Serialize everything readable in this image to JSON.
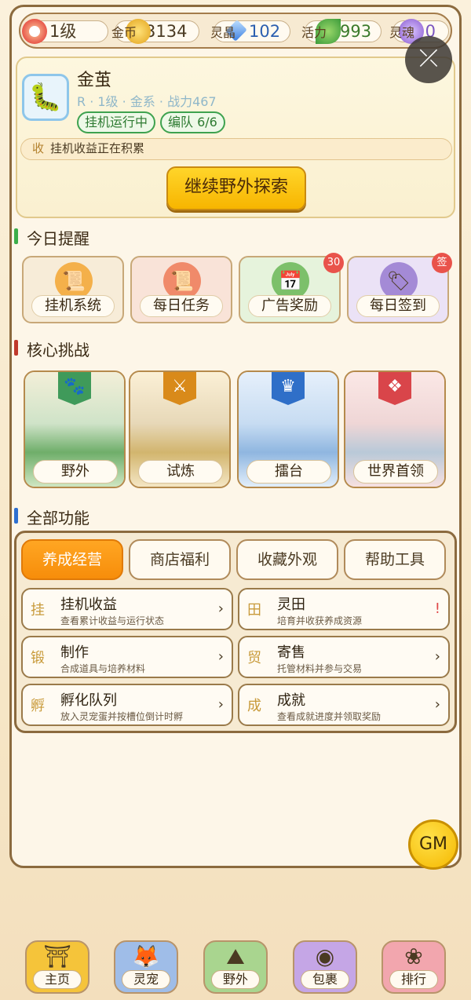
{
  "resources": {
    "level": "1级",
    "gold": {
      "label": "金币",
      "value": "3134"
    },
    "crystal": {
      "label": "灵晶",
      "value": "102"
    },
    "energy": {
      "label": "活力",
      "value": "993"
    },
    "soul": {
      "label": "灵魂",
      "value": "0"
    }
  },
  "pet": {
    "name": "金茧",
    "info": "R · 1级 · 金系 · 战力467",
    "tag_idle": "挂机运行中",
    "tag_team": "编队 6/6",
    "income_key": "收",
    "income_text": "挂机收益正在积累",
    "explore_button": "继续野外探索"
  },
  "reminders": {
    "title": "今日提醒",
    "items": [
      {
        "label": "挂机系统",
        "icon": "scroll-icon"
      },
      {
        "label": "每日任务",
        "icon": "scroll-icon"
      },
      {
        "label": "广告奖励",
        "icon": "calendar-icon",
        "badge": "30"
      },
      {
        "label": "每日签到",
        "icon": "tag-icon",
        "badge": "签"
      }
    ]
  },
  "challenges": {
    "title": "核心挑战",
    "items": [
      {
        "label": "野外",
        "icon": "paw-icon",
        "color": "#3f9a5a"
      },
      {
        "label": "试炼",
        "icon": "swords-icon",
        "color": "#d98a1a"
      },
      {
        "label": "擂台",
        "icon": "crown-icon",
        "color": "#2f6fc8"
      },
      {
        "label": "世界首领",
        "icon": "diamond-icon",
        "color": "#d9454a"
      }
    ]
  },
  "functions": {
    "title": "全部功能",
    "tabs": [
      "养成经营",
      "商店福利",
      "收藏外观",
      "帮助工具"
    ],
    "items": [
      {
        "glyph": "挂",
        "title": "挂机收益",
        "desc": "查看累计收益与运行状态",
        "arrow": "›"
      },
      {
        "glyph": "田",
        "title": "灵田",
        "desc": "培育并收获养成资源",
        "arrow": "!"
      },
      {
        "glyph": "锻",
        "title": "制作",
        "desc": "合成道具与培养材料",
        "arrow": "›"
      },
      {
        "glyph": "贸",
        "title": "寄售",
        "desc": "托管材料并参与交易",
        "arrow": "›"
      },
      {
        "glyph": "孵",
        "title": "孵化队列",
        "desc": "放入灵宠蛋并按槽位倒计时孵",
        "arrow": "›"
      },
      {
        "glyph": "成",
        "title": "成就",
        "desc": "查看成就进度并领取奖励",
        "arrow": "›"
      }
    ]
  },
  "gm_button": "GM",
  "nav": [
    {
      "label": "主页",
      "icon": "temple-icon",
      "color": "#f5c43a"
    },
    {
      "label": "灵宠",
      "icon": "fox-icon",
      "color": "#9fbde8"
    },
    {
      "label": "野外",
      "icon": "mountain-icon",
      "color": "#a9d58f"
    },
    {
      "label": "包裹",
      "icon": "eye-icon",
      "color": "#c5a6e6"
    },
    {
      "label": "排行",
      "icon": "flower-icon",
      "color": "#f2a6ae"
    }
  ]
}
